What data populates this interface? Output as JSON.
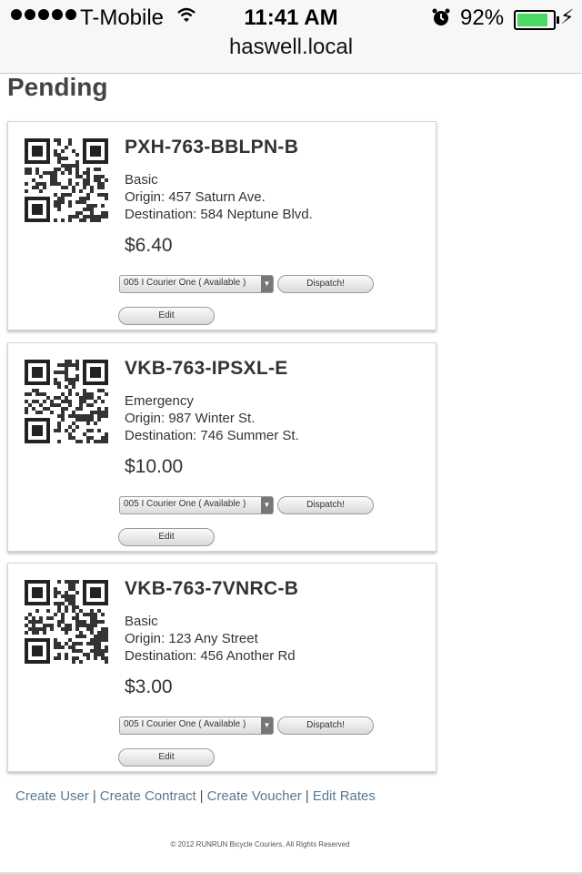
{
  "status_bar": {
    "carrier": "T-Mobile",
    "time": "11:41 AM",
    "battery_percent": "92%",
    "battery_level": 0.92
  },
  "url_bar": {
    "host": "haswell.local"
  },
  "page": {
    "title": "Pending"
  },
  "orders": [
    {
      "code": "PXH-763-BBLPN-B",
      "service": "Basic",
      "origin": "Origin: 457 Saturn Ave.",
      "destination": "Destination: 584 Neptune Blvd.",
      "price": "$6.40",
      "courier_selected": "005 I Courier One ( Available )",
      "dispatch_label": "Dispatch!",
      "edit_label": "Edit"
    },
    {
      "code": "VKB-763-IPSXL-E",
      "service": "Emergency",
      "origin": "Origin: 987 Winter St.",
      "destination": "Destination: 746 Summer St.",
      "price": "$10.00",
      "courier_selected": "005 I Courier One ( Available )",
      "dispatch_label": "Dispatch!",
      "edit_label": "Edit"
    },
    {
      "code": "VKB-763-7VNRC-B",
      "service": "Basic",
      "origin": "Origin: 123 Any Street",
      "destination": "Destination: 456 Another Rd",
      "price": "$3.00",
      "courier_selected": "005 I Courier One ( Available )",
      "dispatch_label": "Dispatch!",
      "edit_label": "Edit"
    }
  ],
  "footer": {
    "links": [
      "Create User",
      "Create Contract",
      "Create Voucher",
      "Edit Rates"
    ],
    "copyright": "© 2012 RUNRUN Bicycle Couriers. All Rights Reserved"
  },
  "icons": {
    "signal": "signal-dots-icon",
    "wifi": "wifi-icon",
    "alarm": "alarm-clock-icon",
    "battery": "battery-icon",
    "charging": "charging-bolt-icon",
    "qr": "qr-code-icon",
    "dropdown": "chevron-down-icon"
  },
  "colors": {
    "battery_fill": "#4cd964",
    "link": "#5a7892"
  }
}
